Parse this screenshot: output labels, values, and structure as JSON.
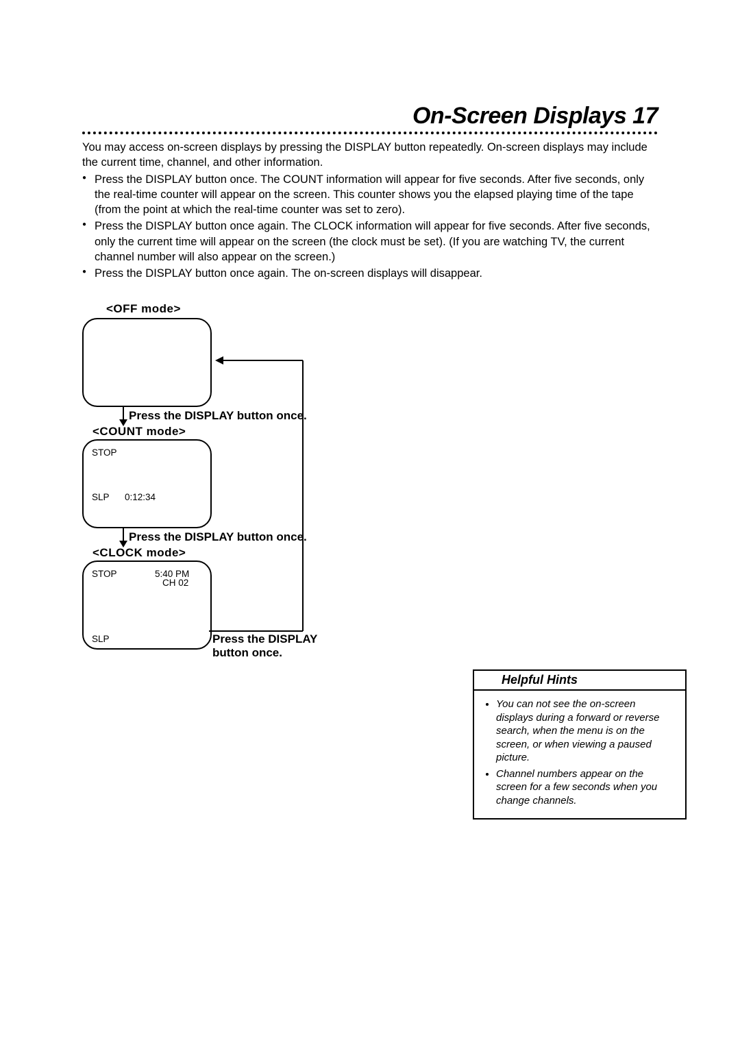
{
  "title": "On-Screen Displays 17",
  "intro": "You may access on-screen displays by pressing the DISPLAY button repeatedly. On-screen displays may include the current time, channel, and other information.",
  "bullets": [
    "Press the DISPLAY button once. The COUNT information will appear for five seconds. After five seconds, only the real-time counter will appear on the screen. This counter shows you the elapsed playing time of the tape (from the point at which the real-time counter was set to zero).",
    "Press the DISPLAY button once again. The CLOCK information will appear for five seconds. After five seconds, only the current time will appear on the screen (the clock must be set). (If you are watching TV, the current channel number will also appear on the screen.)",
    "Press the DISPLAY button once again. The on-screen displays will disappear."
  ],
  "modes": {
    "off": "<OFF mode>",
    "count": "<COUNT mode>",
    "clock": "<CLOCK mode>"
  },
  "instructions": {
    "press1": "Press the DISPLAY button once.",
    "press2": "Press the DISPLAY button once.",
    "press3": "Press the DISPLAY button once."
  },
  "osd": {
    "count": {
      "stop": "STOP",
      "slp": "SLP",
      "counter": "0:12:34"
    },
    "clock": {
      "stop": "STOP",
      "time": "5:40 PM",
      "channel": "CH 02",
      "slp": "SLP"
    }
  },
  "hints": {
    "title": "Helpful Hints",
    "items": [
      "You can not see the on-screen displays during a forward or reverse search, when the menu is on the screen, or when viewing a paused picture.",
      "Channel numbers appear on the screen for a few seconds when you change channels."
    ]
  }
}
